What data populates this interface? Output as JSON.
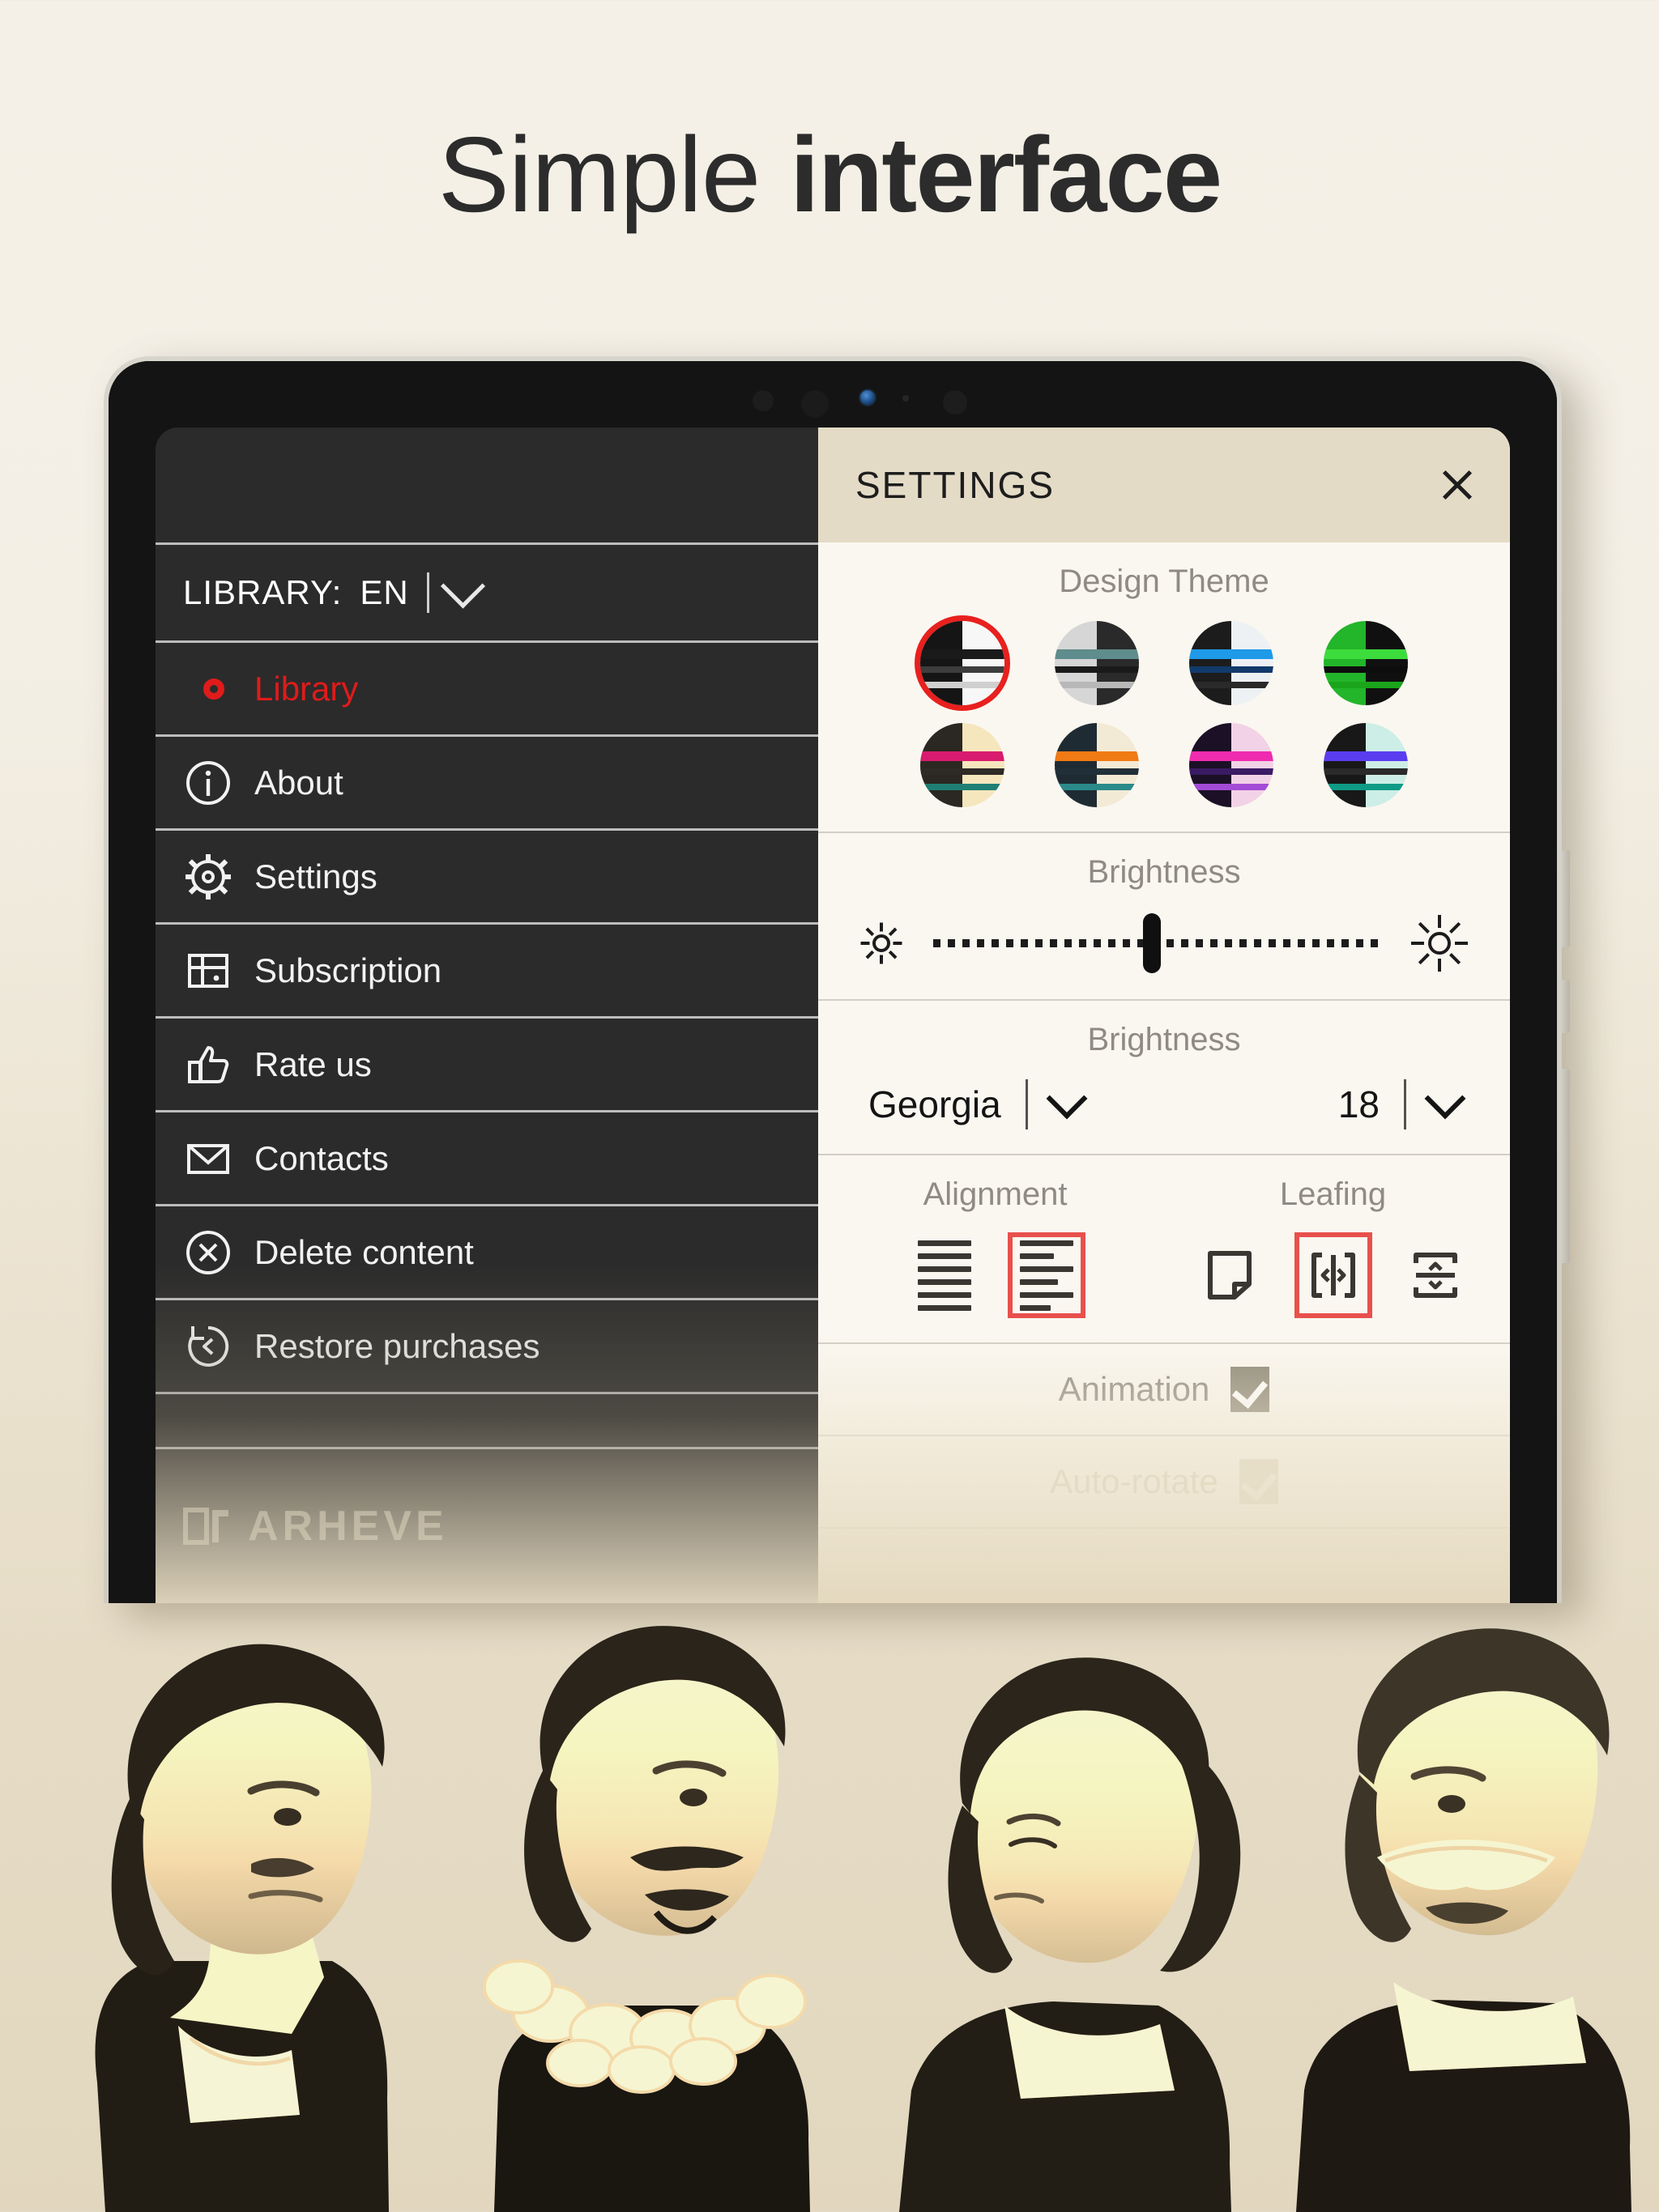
{
  "headline": {
    "thin": "Simple",
    "bold": "interface"
  },
  "device": {
    "camera_icons": [
      "sensor-icon",
      "sensor-icon",
      "camera-lens-icon",
      "sensor-dot-icon",
      "sensor-icon"
    ],
    "side_buttons": [
      "volume-up-button",
      "volume-down-button",
      "power-button"
    ]
  },
  "sidebar": {
    "library_bar": {
      "label": "LIBRARY:",
      "value": "EN",
      "chevron": "chevron-down-icon"
    },
    "items": [
      {
        "label": "Library",
        "icon": "ring-dot-icon",
        "active": true
      },
      {
        "label": "About",
        "icon": "info-circle-icon",
        "active": false
      },
      {
        "label": "Settings",
        "icon": "gear-icon",
        "active": false
      },
      {
        "label": "Subscription",
        "icon": "card-icon",
        "active": false
      },
      {
        "label": "Rate us",
        "icon": "thumbs-up-icon",
        "active": false
      },
      {
        "label": "Contacts",
        "icon": "envelope-icon",
        "active": false
      },
      {
        "label": "Delete content",
        "icon": "x-circle-icon",
        "active": false
      },
      {
        "label": "Restore purchases",
        "icon": "restore-clock-icon",
        "active": false
      }
    ],
    "brand": {
      "name": "ARHEVE",
      "logo": "arheve-logo-icon"
    },
    "active_color": "#e01b1b"
  },
  "settings": {
    "title": "SETTINGS",
    "close_icon": "close-icon",
    "design_theme": {
      "label": "Design Theme",
      "selected_index": 0,
      "selection_color": "#e8201e",
      "swatches": [
        {
          "name": "classic-light",
          "left": "#151515",
          "right": "#f7f7f7",
          "bands": [
            "#1a1a1a",
            "#3d3d3d",
            "#cfcfcf"
          ]
        },
        {
          "name": "slate-grey",
          "left": "#d6d6d6",
          "right": "#2a2a2a",
          "bands": [
            "#5f8c8c",
            "#1a1a1a",
            "#b8b8b8"
          ]
        },
        {
          "name": "blue-ink",
          "left": "#1c1c1c",
          "right": "#eef1f3",
          "bands": [
            "#1e9ae8",
            "#123a6b",
            "#2a2a2a"
          ]
        },
        {
          "name": "green-terminal",
          "left": "#23b52a",
          "right": "#101010",
          "bands": [
            "#3ddc3d",
            "#0d0d0d",
            "#1aa51a"
          ]
        },
        {
          "name": "amber-cream",
          "left": "#2b2722",
          "right": "#f6e6bd",
          "bands": [
            "#d81b6e",
            "#2e2a26",
            "#1f7f74"
          ]
        },
        {
          "name": "orange-dark",
          "left": "#1f2b33",
          "right": "#f3ead6",
          "bands": [
            "#f07a14",
            "#213038",
            "#2a8a8a"
          ]
        },
        {
          "name": "magenta-violet",
          "left": "#1b1026",
          "right": "#f2d2e6",
          "bands": [
            "#ef2bb0",
            "#3b1b63",
            "#a34bd6"
          ]
        },
        {
          "name": "cyan-spectrum",
          "left": "#181818",
          "right": "#cdeee6",
          "bands": [
            "#5b3df0",
            "#2a2a2a",
            "#0f9b86"
          ]
        }
      ]
    },
    "brightness": {
      "label": "Brightness",
      "low_icon": "sun-small-icon",
      "high_icon": "sun-large-icon",
      "value_percent": 47
    },
    "font": {
      "label": "Brightness",
      "family_value": "Georgia",
      "family_chevron": "chevron-down-icon",
      "size_value": "18",
      "size_chevron": "chevron-down-icon"
    },
    "alignment": {
      "label": "Alignment",
      "options": [
        {
          "name": "align-justify-icon",
          "selected": false
        },
        {
          "name": "align-left-icon",
          "selected": true
        }
      ]
    },
    "leafing": {
      "label": "Leafing",
      "options": [
        {
          "name": "page-curl-icon",
          "selected": false
        },
        {
          "name": "horizontal-scroll-icon",
          "selected": true
        },
        {
          "name": "vertical-scroll-icon",
          "selected": false
        }
      ]
    },
    "toggles": [
      {
        "label": "Animation",
        "checked": true,
        "dimmed": false
      },
      {
        "label": "Auto-rotate",
        "checked": true,
        "dimmed": true
      }
    ],
    "selection_outline_color": "#e8504c"
  },
  "portraits": [
    {
      "name": "portrait-balzac"
    },
    {
      "name": "portrait-cervantes"
    },
    {
      "name": "portrait-woman"
    },
    {
      "name": "portrait-doyle"
    }
  ]
}
